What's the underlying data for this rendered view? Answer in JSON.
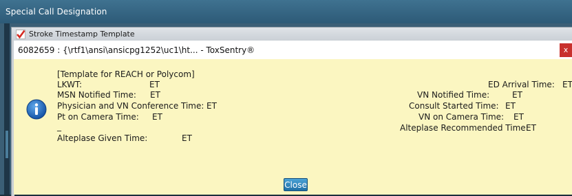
{
  "outer_window": {
    "title": "Special Call Designation"
  },
  "inner_window": {
    "title": "Stroke Timestamp Template",
    "icon": "red-check-icon"
  },
  "message": {
    "title": "6082659 : {\\rtf1\\ansi\\ansicpg1252\\uc1\\ht... - ToxSentry®",
    "close_x": "x",
    "icon": "info-icon",
    "template_header": "[Template for REACH or Polycom]",
    "left_fields": [
      {
        "label": "LKWT:",
        "value": "ET"
      },
      {
        "label": "MSN Notified Time:",
        "value": "ET"
      },
      {
        "label": "Physician and VN Conference Time:",
        "value": "ET"
      },
      {
        "label": "Pt on Camera Time:",
        "value": "ET"
      },
      {
        "label": "_",
        "value": ""
      },
      {
        "label": "Alteplase Given Time:",
        "value": "ET"
      }
    ],
    "right_fields": [
      {
        "label": "ED Arrival Time:",
        "value": "ET"
      },
      {
        "label": "VN Notified Time:",
        "value": "ET"
      },
      {
        "label": "Consult Started Time:",
        "value": "ET"
      },
      {
        "label": "VN on Camera Time:",
        "value": "ET"
      },
      {
        "label": "Alteplase Recommended Time:",
        "value": "ET"
      }
    ],
    "close_button": "Close"
  },
  "colors": {
    "message_background": "#fbf6c1",
    "close_button": "#2b83bf",
    "title_bar": "#3f7290"
  }
}
